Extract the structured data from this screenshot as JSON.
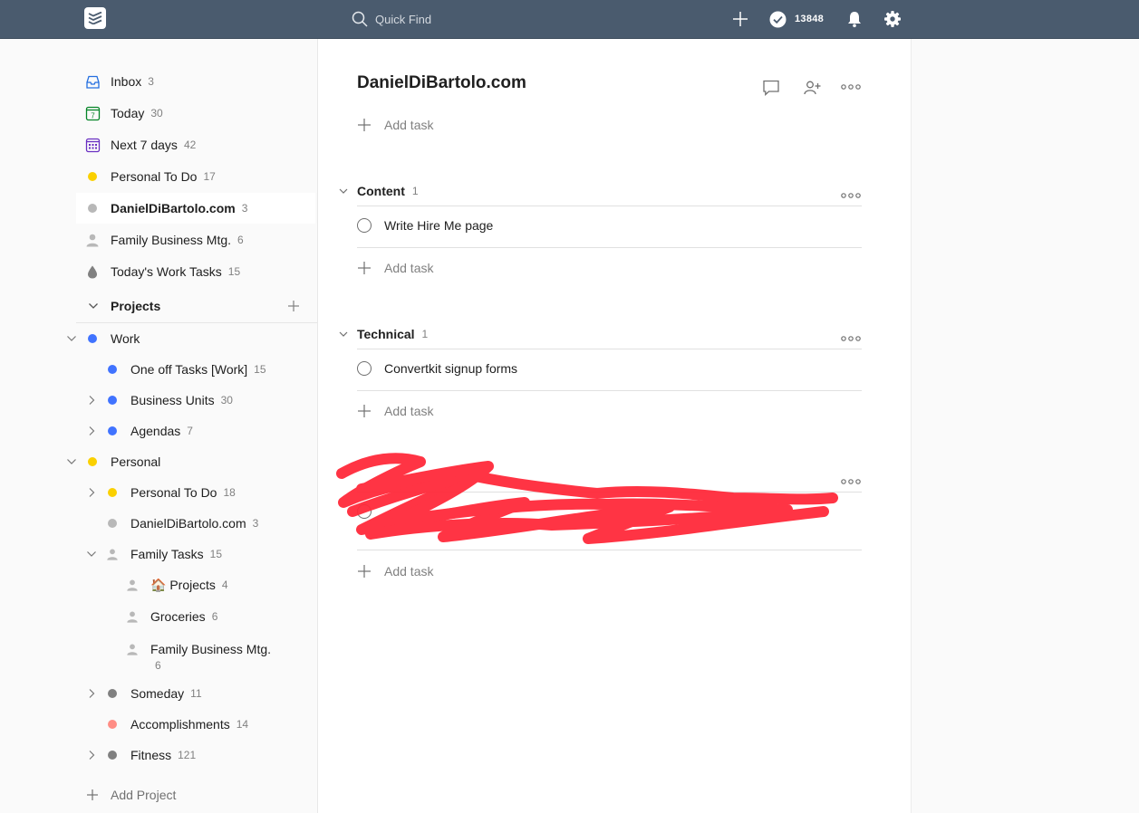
{
  "topbar": {
    "search_placeholder": "Quick Find",
    "karma": "13848",
    "background": "#4a5b6e"
  },
  "sidebar": {
    "filters": [
      {
        "label": "Inbox",
        "count": "3",
        "icon": "inbox-icon",
        "color": "#246fe0"
      },
      {
        "label": "Today",
        "count": "30",
        "icon": "calendar-today-icon",
        "color": "#058527"
      },
      {
        "label": "Next 7 days",
        "count": "42",
        "icon": "calendar-week-icon",
        "color": "#692fc2"
      },
      {
        "label": "Personal To Do",
        "count": "17",
        "icon": "dot-icon",
        "color": "#fad000"
      },
      {
        "label": "DanielDiBartolo.com",
        "count": "3",
        "icon": "dot-icon",
        "color": "#b8b8b8"
      },
      {
        "label": "Family Business Mtg.",
        "count": "6",
        "icon": "person-icon",
        "color": "#b8b8b8"
      },
      {
        "label": "Today's Work Tasks",
        "count": "15",
        "icon": "drop-icon",
        "color": "#808080"
      }
    ],
    "projects_header": "Projects",
    "projects": [
      {
        "label": "Work",
        "count": "",
        "color": "#4073ff"
      },
      {
        "label": "One off Tasks [Work]",
        "count": "15",
        "color": "#4073ff"
      },
      {
        "label": "Business Units",
        "count": "30",
        "color": "#4073ff"
      },
      {
        "label": "Agendas",
        "count": "7",
        "color": "#4073ff"
      },
      {
        "label": "Personal",
        "count": "",
        "color": "#fad000"
      },
      {
        "label": "Personal To Do",
        "count": "18",
        "color": "#fad000"
      },
      {
        "label": "DanielDiBartolo.com",
        "count": "3",
        "color": "#b8b8b8"
      },
      {
        "label": "Family Tasks",
        "count": "15",
        "color": "#b8b8b8"
      },
      {
        "label": "🏠 Projects",
        "count": "4",
        "color": "#b8b8b8"
      },
      {
        "label": "Groceries",
        "count": "6",
        "color": "#b8b8b8"
      },
      {
        "label": "Family Business Mtg.",
        "count": "6",
        "color": "#b8b8b8"
      },
      {
        "label": "Someday",
        "count": "11",
        "color": "#808080"
      },
      {
        "label": "Accomplishments",
        "count": "14",
        "color": "#ff8d85"
      },
      {
        "label": "Fitness",
        "count": "121",
        "color": "#808080"
      }
    ],
    "add_project": "Add Project"
  },
  "main": {
    "title": "DanielDiBartolo.com",
    "add_task": "Add task",
    "sections": [
      {
        "name": "Content",
        "count": "1",
        "tasks": [
          "Write Hire Me page"
        ]
      },
      {
        "name": "Technical",
        "count": "1",
        "tasks": [
          "Convertkit signup forms"
        ]
      }
    ],
    "redaction_color": "#ff2a3a"
  }
}
